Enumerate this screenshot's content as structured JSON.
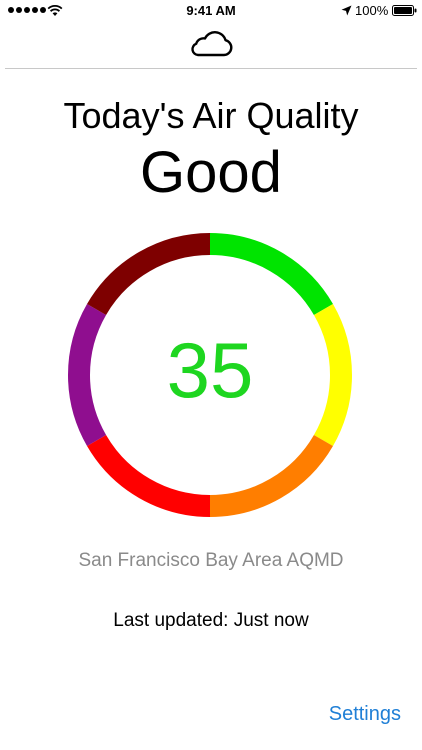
{
  "status_bar": {
    "time": "9:41 AM",
    "battery": "100%"
  },
  "header": {
    "icon": "cloud-icon"
  },
  "air_quality": {
    "title": "Today's Air Quality",
    "level": "Good",
    "aqi": "35",
    "aqi_color": "#1ed620"
  },
  "gauge": {
    "segments": [
      {
        "color": "#00e400"
      },
      {
        "color": "#ffff00"
      },
      {
        "color": "#ff7e00"
      },
      {
        "color": "#ff0000"
      },
      {
        "color": "#8f0e8f"
      },
      {
        "color": "#7e0000"
      }
    ]
  },
  "source": {
    "agency": "San Francisco Bay Area AQMD",
    "updated": "Last updated: Just now"
  },
  "footer": {
    "settings_label": "Settings",
    "link_color": "#1f7fd6"
  }
}
